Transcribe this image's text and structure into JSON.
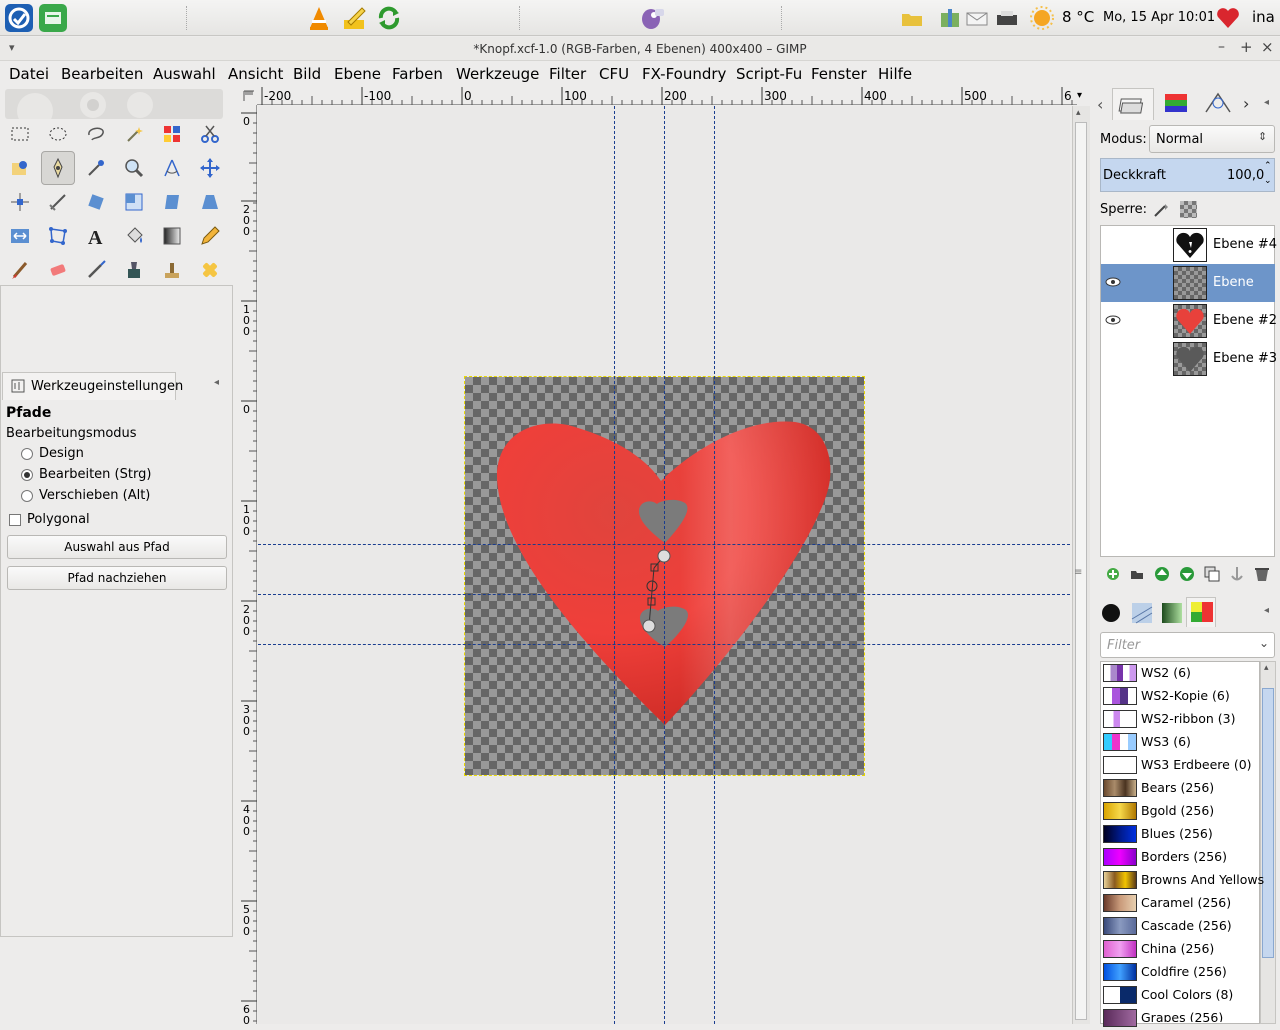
{
  "top_panel": {
    "weather": "8 °C",
    "clock": "Mo, 15 Apr  10:01",
    "user": "ina"
  },
  "window": {
    "title": "*Knopf.xcf-1.0 (RGB-Farben, 4 Ebenen) 400x400 – GIMP"
  },
  "menu": {
    "datei": "Datei",
    "bearbeiten": "Bearbeiten",
    "auswahl": "Auswahl",
    "ansicht": "Ansicht",
    "bild": "Bild",
    "ebene": "Ebene",
    "farben": "Farben",
    "werkzeuge": "Werkzeuge",
    "filter": "Filter",
    "cfu": "CFU",
    "fxfoundry": "FX-Foundry",
    "scriptfu": "Script-Fu",
    "fenster": "Fenster",
    "hilfe": "Hilfe"
  },
  "tool_options": {
    "tab_label": "Werkzeugeinstellungen",
    "tool_name": "Pfade",
    "mode_label": "Bearbeitungsmodus",
    "mode_design": "Design",
    "mode_edit": "Bearbeiten (Strg)",
    "mode_move": "Verschieben (Alt)",
    "polygonal": "Polygonal",
    "btn_selection_from_path": "Auswahl aus Pfad",
    "btn_stroke_path": "Pfad nachziehen"
  },
  "colors": {
    "foreground": "#000000",
    "background": "#9ebd74",
    "selection_accent": "#6d95c9",
    "heart": "#ef3f3a"
  },
  "rulers": {
    "h_labels": [
      "-200",
      "-100",
      "0",
      "100",
      "200",
      "300",
      "400",
      "500",
      "6"
    ],
    "v_labels": [
      "0",
      "200",
      "100",
      "0",
      "100",
      "200",
      "300",
      "400",
      "500",
      "600"
    ]
  },
  "layers_panel": {
    "mode_label": "Modus:",
    "mode_value": "Normal",
    "opacity_label": "Deckkraft",
    "opacity_value": "100,0",
    "lock_label": "Sperre:",
    "layers": [
      {
        "name": "Ebene #4",
        "visible": false,
        "selected": false
      },
      {
        "name": "Ebene",
        "visible": true,
        "selected": true
      },
      {
        "name": "Ebene #2",
        "visible": true,
        "selected": false
      },
      {
        "name": "Ebene #3",
        "visible": false,
        "selected": false
      }
    ]
  },
  "gradients_panel": {
    "filter_placeholder": "Filter",
    "items": [
      {
        "label": "WS2 (6)"
      },
      {
        "label": "WS2-Kopie (6)"
      },
      {
        "label": "WS2-ribbon (3)"
      },
      {
        "label": "WS3 (6)"
      },
      {
        "label": "WS3 Erdbeere (0)"
      },
      {
        "label": "Bears (256)"
      },
      {
        "label": "Bgold (256)"
      },
      {
        "label": "Blues (256)"
      },
      {
        "label": "Borders (256)"
      },
      {
        "label": "Browns And Yellows"
      },
      {
        "label": "Caramel (256)"
      },
      {
        "label": "Cascade (256)"
      },
      {
        "label": "China (256)"
      },
      {
        "label": "Coldfire (256)"
      },
      {
        "label": "Cool Colors (8)"
      },
      {
        "label": "Grapes (256)"
      }
    ]
  }
}
